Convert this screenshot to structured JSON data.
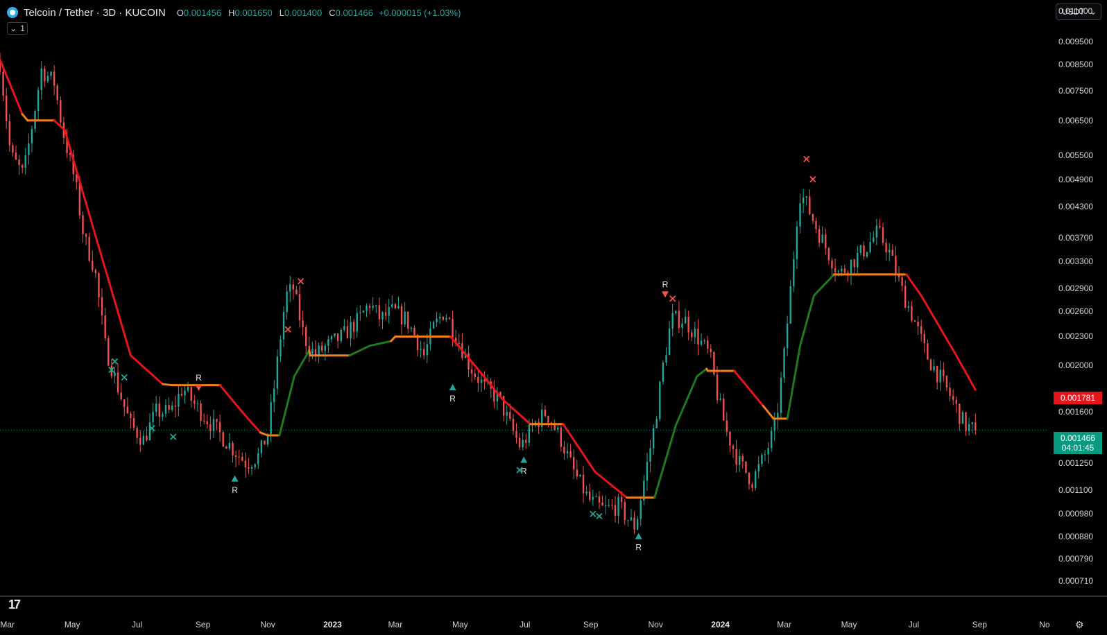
{
  "header": {
    "symbol": "Telcoin / Tether · 3D · KUCOIN",
    "o_key": "O",
    "o_val": "0.001456",
    "h_key": "H",
    "h_val": "0.001650",
    "l_key": "L",
    "l_val": "0.001400",
    "c_key": "C",
    "c_val": "0.001466",
    "change": "+0.000015 (+1.03%)",
    "indicator_count": "1"
  },
  "currency_selector": {
    "label": "USDT",
    "icon": "chevron-down-icon"
  },
  "price_tags": {
    "last_price": "0.001466",
    "countdown": "04:01:45",
    "indicator_value": "0.001781"
  },
  "watermark": {
    "icon": "tradingview-logo-icon",
    "text": "17"
  },
  "settings_icon": "gear-icon",
  "colors": {
    "up": "#26a69a",
    "down": "#ef5350",
    "trail_down": "#e8141b",
    "trail_up": "#1f7a1f",
    "trail_flat": "#f57f17",
    "background": "#000000"
  },
  "chart_data": {
    "type": "candlestick",
    "symbol": "TEL/USDT",
    "timeframe": "3D",
    "exchange": "KUCOIN",
    "y_scale": "log",
    "ylim": [
      0.00066,
      0.0116
    ],
    "y_ticks": [
      "0.011000",
      "0.009500",
      "0.008500",
      "0.007500",
      "0.006500",
      "0.005500",
      "0.004900",
      "0.004300",
      "0.003700",
      "0.003300",
      "0.002900",
      "0.002600",
      "0.002300",
      "0.002000",
      "0.001600",
      "0.001250",
      "0.001100",
      "0.000980",
      "0.000880",
      "0.000790",
      "0.000710"
    ],
    "x_ticks": [
      {
        "label": "Mar",
        "date": "2022-03-01"
      },
      {
        "label": "May",
        "date": "2022-05-01"
      },
      {
        "label": "Jul",
        "date": "2022-07-01"
      },
      {
        "label": "Sep",
        "date": "2022-09-01"
      },
      {
        "label": "Nov",
        "date": "2022-11-01"
      },
      {
        "label": "2023",
        "date": "2023-01-01",
        "bold": true
      },
      {
        "label": "Mar",
        "date": "2023-03-01"
      },
      {
        "label": "May",
        "date": "2023-05-01"
      },
      {
        "label": "Jul",
        "date": "2023-07-01"
      },
      {
        "label": "Sep",
        "date": "2023-09-01"
      },
      {
        "label": "Nov",
        "date": "2023-11-01"
      },
      {
        "label": "2024",
        "date": "2024-01-01",
        "bold": true
      },
      {
        "label": "Mar",
        "date": "2024-03-01"
      },
      {
        "label": "May",
        "date": "2024-05-01"
      },
      {
        "label": "Jul",
        "date": "2024-07-01"
      },
      {
        "label": "Sep",
        "date": "2024-09-01"
      },
      {
        "label": "No",
        "date": "2024-11-01"
      }
    ],
    "x_range": [
      "2022-02-22",
      "2024-11-05"
    ],
    "last_bar": "2024-08-28",
    "price_path": [
      [
        "2022-02-22",
        0.0086
      ],
      [
        "2022-03-04",
        0.0055
      ],
      [
        "2022-03-16",
        0.005
      ],
      [
        "2022-03-25",
        0.0065
      ],
      [
        "2022-04-02",
        0.0083
      ],
      [
        "2022-04-14",
        0.0078
      ],
      [
        "2022-04-22",
        0.0062
      ],
      [
        "2022-05-04",
        0.0048
      ],
      [
        "2022-05-12",
        0.0037
      ],
      [
        "2022-05-22",
        0.0032
      ],
      [
        "2022-06-01",
        0.0022
      ],
      [
        "2022-06-13",
        0.0018
      ],
      [
        "2022-06-25",
        0.0015
      ],
      [
        "2022-07-07",
        0.0014
      ],
      [
        "2022-07-19",
        0.0016
      ],
      [
        "2022-08-02",
        0.0016
      ],
      [
        "2022-08-13",
        0.0018
      ],
      [
        "2022-08-25",
        0.00165
      ],
      [
        "2022-09-10",
        0.0015
      ],
      [
        "2022-09-28",
        0.00135
      ],
      [
        "2022-10-12",
        0.00125
      ],
      [
        "2022-10-24",
        0.0013
      ],
      [
        "2022-11-01",
        0.00145
      ],
      [
        "2022-11-07",
        0.0018
      ],
      [
        "2022-11-13",
        0.0023
      ],
      [
        "2022-11-18",
        0.0028
      ],
      [
        "2022-11-25",
        0.0029
      ],
      [
        "2022-12-05",
        0.0023
      ],
      [
        "2022-12-15",
        0.0021
      ],
      [
        "2022-12-27",
        0.0022
      ],
      [
        "2023-01-10",
        0.0023
      ],
      [
        "2023-01-26",
        0.0025
      ],
      [
        "2023-02-05",
        0.0027
      ],
      [
        "2023-02-15",
        0.0025
      ],
      [
        "2023-02-27",
        0.0026
      ],
      [
        "2023-03-11",
        0.0025
      ],
      [
        "2023-03-20",
        0.0023
      ],
      [
        "2023-03-28",
        0.0021
      ],
      [
        "2023-04-06",
        0.0024
      ],
      [
        "2023-04-16",
        0.0026
      ],
      [
        "2023-04-28",
        0.0023
      ],
      [
        "2023-05-10",
        0.002
      ],
      [
        "2023-05-24",
        0.0018
      ],
      [
        "2023-06-07",
        0.0017
      ],
      [
        "2023-06-17",
        0.0015
      ],
      [
        "2023-06-27",
        0.00135
      ],
      [
        "2023-07-09",
        0.0015
      ],
      [
        "2023-07-21",
        0.0016
      ],
      [
        "2023-08-04",
        0.0014
      ],
      [
        "2023-08-16",
        0.0012
      ],
      [
        "2023-08-30",
        0.00105
      ],
      [
        "2023-09-13",
        0.001
      ],
      [
        "2023-09-27",
        0.00102
      ],
      [
        "2023-10-07",
        0.00095
      ],
      [
        "2023-10-13",
        0.00092
      ],
      [
        "2023-10-21",
        0.00115
      ],
      [
        "2023-10-31",
        0.0015
      ],
      [
        "2023-11-08",
        0.002
      ],
      [
        "2023-11-16",
        0.0025
      ],
      [
        "2023-11-28",
        0.0025
      ],
      [
        "2023-12-10",
        0.0023
      ],
      [
        "2023-12-22",
        0.0021
      ],
      [
        "2023-12-30",
        0.0017
      ],
      [
        "2024-01-07",
        0.00145
      ],
      [
        "2024-01-19",
        0.00125
      ],
      [
        "2024-01-31",
        0.00115
      ],
      [
        "2024-02-12",
        0.0013
      ],
      [
        "2024-02-22",
        0.0015
      ],
      [
        "2024-03-01",
        0.0021
      ],
      [
        "2024-03-09",
        0.0032
      ],
      [
        "2024-03-15",
        0.0046
      ],
      [
        "2024-03-21",
        0.0044
      ],
      [
        "2024-03-31",
        0.0039
      ],
      [
        "2024-04-10",
        0.0035
      ],
      [
        "2024-04-22",
        0.0031
      ],
      [
        "2024-05-04",
        0.0033
      ],
      [
        "2024-05-16",
        0.0035
      ],
      [
        "2024-05-28",
        0.0038
      ],
      [
        "2024-06-07",
        0.0035
      ],
      [
        "2024-06-19",
        0.0029
      ],
      [
        "2024-07-01",
        0.0025
      ],
      [
        "2024-07-13",
        0.0021
      ],
      [
        "2024-07-25",
        0.0019
      ],
      [
        "2024-08-06",
        0.0017
      ],
      [
        "2024-08-18",
        0.0015
      ],
      [
        "2024-08-28",
        0.001466
      ]
    ],
    "trailing_line": [
      [
        "2022-02-22",
        0.0087,
        "down"
      ],
      [
        "2022-03-15",
        0.0067,
        "down"
      ],
      [
        "2022-03-20",
        0.0065,
        "flat"
      ],
      [
        "2022-04-14",
        0.0065,
        "flat"
      ],
      [
        "2022-04-24",
        0.0062,
        "down"
      ],
      [
        "2022-05-25",
        0.0036,
        "down"
      ],
      [
        "2022-06-25",
        0.0021,
        "down"
      ],
      [
        "2022-07-25",
        0.00183,
        "down"
      ],
      [
        "2022-08-03",
        0.00182,
        "flat"
      ],
      [
        "2022-09-17",
        0.00182,
        "flat"
      ],
      [
        "2022-10-08",
        0.0016,
        "down"
      ],
      [
        "2022-10-25",
        0.00145,
        "down"
      ],
      [
        "2022-11-01",
        0.00143,
        "flat"
      ],
      [
        "2022-11-12",
        0.00143,
        "flat"
      ],
      [
        "2022-11-26",
        0.0019,
        "up"
      ],
      [
        "2022-12-10",
        0.00215,
        "up"
      ],
      [
        "2022-12-11",
        0.0021,
        "flat"
      ],
      [
        "2023-01-17",
        0.0021,
        "flat"
      ],
      [
        "2023-02-05",
        0.0022,
        "up"
      ],
      [
        "2023-02-25",
        0.00225,
        "up"
      ],
      [
        "2023-03-01",
        0.0023,
        "flat"
      ],
      [
        "2023-04-22",
        0.0023,
        "flat"
      ],
      [
        "2023-05-15",
        0.002,
        "down"
      ],
      [
        "2023-06-10",
        0.0017,
        "down"
      ],
      [
        "2023-07-06",
        0.00151,
        "down"
      ],
      [
        "2023-07-10",
        0.00151,
        "flat"
      ],
      [
        "2023-08-06",
        0.00151,
        "flat"
      ],
      [
        "2023-09-05",
        0.0012,
        "down"
      ],
      [
        "2023-10-05",
        0.00106,
        "down"
      ],
      [
        "2023-10-13",
        0.00106,
        "flat"
      ],
      [
        "2023-10-31",
        0.00106,
        "flat"
      ],
      [
        "2023-11-20",
        0.0015,
        "up"
      ],
      [
        "2023-12-10",
        0.0019,
        "up"
      ],
      [
        "2023-12-19",
        0.00197,
        "up"
      ],
      [
        "2023-12-20",
        0.00195,
        "flat"
      ],
      [
        "2024-01-14",
        0.00195,
        "flat"
      ],
      [
        "2024-02-10",
        0.00165,
        "down"
      ],
      [
        "2024-02-20",
        0.00155,
        "flat"
      ],
      [
        "2024-03-04",
        0.00155,
        "flat"
      ],
      [
        "2024-03-16",
        0.0022,
        "up"
      ],
      [
        "2024-03-29",
        0.0028,
        "up"
      ],
      [
        "2024-04-17",
        0.0031,
        "up"
      ],
      [
        "2024-04-20",
        0.0031,
        "flat"
      ],
      [
        "2024-06-24",
        0.0031,
        "flat"
      ],
      [
        "2024-07-08",
        0.0028,
        "down"
      ],
      [
        "2024-08-10",
        0.0021,
        "down"
      ],
      [
        "2024-08-28",
        0.001781,
        "down"
      ]
    ],
    "signals": [
      {
        "date": "2022-06-07",
        "price": 0.00196,
        "kind": "cross",
        "color": "up"
      },
      {
        "date": "2022-06-10",
        "price": 0.00204,
        "kind": "cross",
        "color": "up"
      },
      {
        "date": "2022-06-19",
        "price": 0.00189,
        "kind": "cross",
        "color": "up"
      },
      {
        "date": "2022-07-15",
        "price": 0.00148,
        "kind": "cross",
        "color": "up"
      },
      {
        "date": "2022-08-04",
        "price": 0.00142,
        "kind": "cross",
        "color": "up"
      },
      {
        "date": "2022-08-28",
        "price": 0.0018,
        "kind": "triangle-down",
        "color": "down",
        "label": "R"
      },
      {
        "date": "2022-10-01",
        "price": 0.00116,
        "kind": "triangle-up",
        "color": "up",
        "label": "R"
      },
      {
        "date": "2022-11-20",
        "price": 0.00238,
        "kind": "cross",
        "color": "down"
      },
      {
        "date": "2022-12-02",
        "price": 0.003,
        "kind": "cross",
        "color": "down"
      },
      {
        "date": "2023-04-24",
        "price": 0.0018,
        "kind": "triangle-up",
        "color": "up",
        "label": "R"
      },
      {
        "date": "2023-06-30",
        "price": 0.00127,
        "kind": "triangle-up",
        "color": "up",
        "label": "R"
      },
      {
        "date": "2023-06-26",
        "price": 0.00121,
        "kind": "cross",
        "color": "up"
      },
      {
        "date": "2023-09-03",
        "price": 0.00098,
        "kind": "cross",
        "color": "up"
      },
      {
        "date": "2023-09-09",
        "price": 0.00097,
        "kind": "cross",
        "color": "up"
      },
      {
        "date": "2023-10-16",
        "price": 0.00088,
        "kind": "triangle-up",
        "color": "up",
        "label": "R"
      },
      {
        "date": "2023-11-10",
        "price": 0.00282,
        "kind": "triangle-down",
        "color": "down",
        "label": "R"
      },
      {
        "date": "2023-11-17",
        "price": 0.00276,
        "kind": "cross",
        "color": "down"
      },
      {
        "date": "2024-03-22",
        "price": 0.0054,
        "kind": "cross",
        "color": "down"
      },
      {
        "date": "2024-03-28",
        "price": 0.0049,
        "kind": "cross",
        "color": "down"
      }
    ]
  }
}
